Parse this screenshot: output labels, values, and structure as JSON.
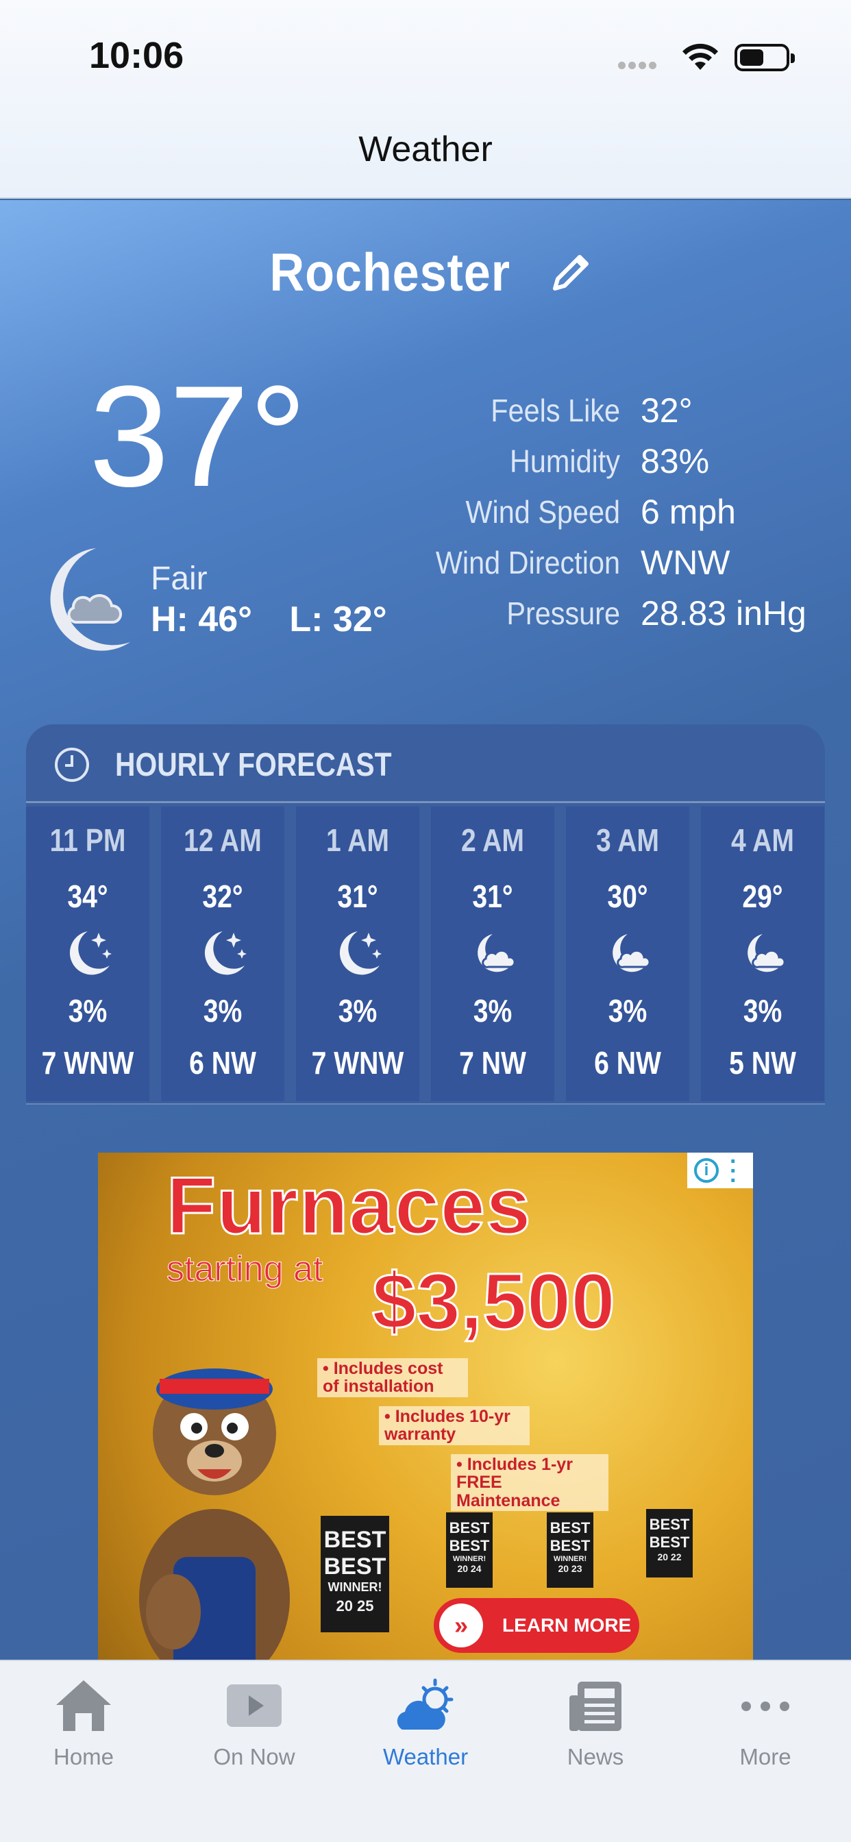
{
  "status_bar": {
    "time": "10:06"
  },
  "header": {
    "title": "Weather"
  },
  "location": {
    "city": "Rochester"
  },
  "current": {
    "temperature": "37°",
    "condition": "Fair",
    "high": "H: 46°",
    "low": "L: 32°",
    "condition_icon": "moon-cloud-icon"
  },
  "details": [
    {
      "label": "Feels Like",
      "value": "32°"
    },
    {
      "label": "Humidity",
      "value": "83%"
    },
    {
      "label": "Wind Speed",
      "value": "6 mph"
    },
    {
      "label": "Wind Direction",
      "value": "WNW"
    },
    {
      "label": "Pressure",
      "value": "28.83 inHg"
    }
  ],
  "hourly": {
    "title": "HOURLY FORECAST",
    "hours": [
      {
        "time": "11 PM",
        "temp": "34°",
        "icon": "moon-stars-icon",
        "precip": "3%",
        "wind": "7 WNW"
      },
      {
        "time": "12 AM",
        "temp": "32°",
        "icon": "moon-stars-icon",
        "precip": "3%",
        "wind": "6 NW"
      },
      {
        "time": "1 AM",
        "temp": "31°",
        "icon": "moon-stars-icon",
        "precip": "3%",
        "wind": "7 WNW"
      },
      {
        "time": "2 AM",
        "temp": "31°",
        "icon": "moon-cloud-icon",
        "precip": "3%",
        "wind": "7 NW"
      },
      {
        "time": "3 AM",
        "temp": "30°",
        "icon": "moon-cloud-icon",
        "precip": "3%",
        "wind": "6 NW"
      },
      {
        "time": "4 AM",
        "temp": "29°",
        "icon": "moon-cloud-icon",
        "precip": "3%",
        "wind": "5 NW"
      }
    ]
  },
  "ad": {
    "headline": "Furnaces",
    "starting_at": "starting at",
    "price": "$3,500",
    "bullets": [
      "• Includes cost of installation",
      "• Includes 10-yr warranty",
      "• Includes 1-yr FREE Maintenance"
    ],
    "badges": [
      {
        "line1": "BEST",
        "line2": "BEST",
        "line3": "WINNER!",
        "years": "20 25"
      },
      {
        "line1": "BEST",
        "line2": "BEST",
        "line3": "WINNER!",
        "years": "20 24"
      },
      {
        "line1": "BEST",
        "line2": "BEST",
        "line3": "WINNER!",
        "years": "20 23"
      },
      {
        "line1": "BEST",
        "line2": "BEST",
        "line3": "",
        "years": "20 22"
      }
    ],
    "cta": "LEARN MORE",
    "info_icon": "info-icon"
  },
  "tabbar": {
    "items": [
      {
        "label": "Home",
        "icon": "home-icon"
      },
      {
        "label": "On Now",
        "icon": "play-icon"
      },
      {
        "label": "Weather",
        "icon": "weather-icon",
        "active": true
      },
      {
        "label": "News",
        "icon": "newspaper-icon"
      },
      {
        "label": "More",
        "icon": "more-dots-icon"
      }
    ]
  },
  "colors": {
    "accent": "#2f7ad6",
    "ad_red": "#e52d36",
    "panel": "#3b5f9f"
  }
}
